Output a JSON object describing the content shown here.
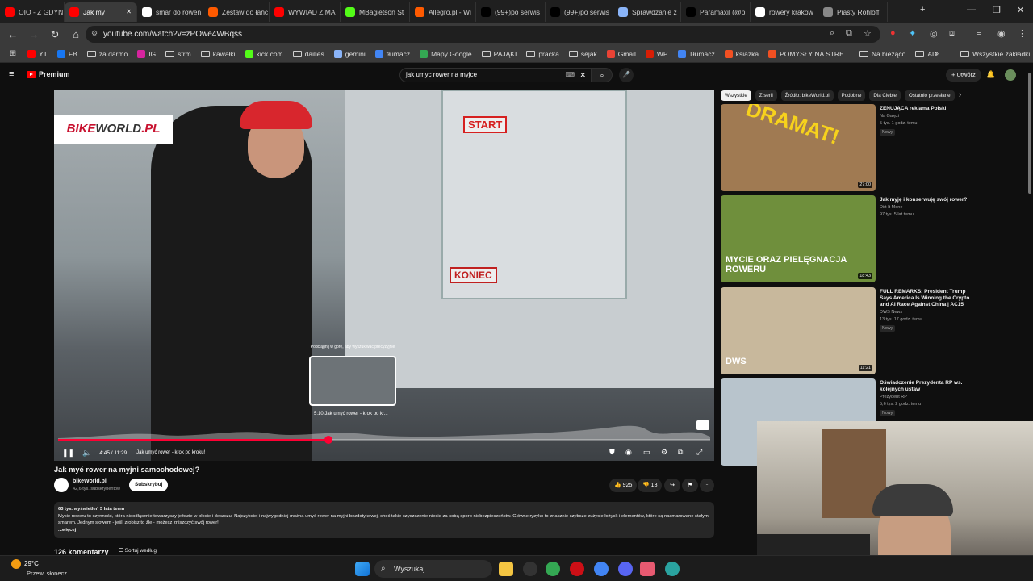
{
  "browser": {
    "tabs": [
      {
        "label": "OIO - Z GDYNI",
        "color": "#ff0000",
        "active": false
      },
      {
        "label": "Jak my",
        "color": "#ff0000",
        "active": true
      },
      {
        "label": "smar do rowen",
        "color": "#ffffff",
        "active": false
      },
      {
        "label": "Zestaw do łańc",
        "color": "#ff5a00",
        "active": false
      },
      {
        "label": "WYWIAD Z MA",
        "color": "#ff0000",
        "active": false
      },
      {
        "label": "MBagietson St",
        "color": "#53fc18",
        "active": false
      },
      {
        "label": "Allegro.pl - Wi",
        "color": "#ff5a00",
        "active": false
      },
      {
        "label": "(99+)po serwis",
        "color": "#000000",
        "active": false
      },
      {
        "label": "(99+)po serwis",
        "color": "#000000",
        "active": false
      },
      {
        "label": "Sprawdzanie z",
        "color": "#8ab4f8",
        "active": false
      },
      {
        "label": "Paramaxil (@p",
        "color": "#000000",
        "active": false
      },
      {
        "label": "rowery krakow",
        "color": "#ffffff",
        "active": false
      },
      {
        "label": "Piasty Rohloff",
        "color": "#888888",
        "active": false
      }
    ],
    "url": "youtube.com/watch?v=zPOwe4WBqss",
    "bookmarks": [
      {
        "label": "YT",
        "kind": "yt"
      },
      {
        "label": "FB",
        "kind": "fb"
      },
      {
        "label": "za darmo",
        "kind": "folder"
      },
      {
        "label": "IG",
        "kind": "ig"
      },
      {
        "label": "strm",
        "kind": "folder"
      },
      {
        "label": "kawałki",
        "kind": "folder"
      },
      {
        "label": "kick.com",
        "kind": "kick"
      },
      {
        "label": "dailies",
        "kind": "folder"
      },
      {
        "label": "gemini",
        "kind": "gemini"
      },
      {
        "label": "tłumacz",
        "kind": "gt"
      },
      {
        "label": "Mapy Google",
        "kind": "maps"
      },
      {
        "label": "PAJĄKI",
        "kind": "folder"
      },
      {
        "label": "pracka",
        "kind": "folder"
      },
      {
        "label": "sejak",
        "kind": "folder"
      },
      {
        "label": "Gmail",
        "kind": "gmail"
      },
      {
        "label": "WP",
        "kind": "wp"
      },
      {
        "label": "Tłumacz",
        "kind": "gt"
      },
      {
        "label": "ksiazka",
        "kind": "ms"
      },
      {
        "label": "POMYSŁY NA STRE...",
        "kind": "ms"
      },
      {
        "label": "Na bieżąco",
        "kind": "folder"
      },
      {
        "label": "AD",
        "kind": "folder"
      }
    ],
    "all_bookmarks": "Wszystkie zakładki"
  },
  "youtube": {
    "logo": "Premium",
    "search_query": "jak umyc rower na myjce",
    "create_label": "Utwórz",
    "player": {
      "brand_watermark": "BIKEWORLD.PL",
      "time": "4:45 / 11:29",
      "chapter": "Jak umyć rower - krok po kroku!",
      "played_fraction": 0.415,
      "preview_hint": "Podciągnij w górę, aby wyszukiwać precyzyjnie",
      "preview_time": "5:10  Jak umyć rower - krok po kr..."
    },
    "video_title": "Jak myć rower na myjni samochodowej?",
    "channel": {
      "name": "bikeWorld.pl",
      "subs": "42,6 tys. subskrybentów"
    },
    "subscribe_label": "Subskrybuj",
    "likes": "925",
    "dislikes": "18",
    "description": {
      "views": "63 tys. wyświetleń  3 lata temu",
      "text": "Mycie roweru to czynność, która nieodłącznie towarzyszy jeździe w błocie i deszczu. Najszybciej i najwygodniej można umyć rower na myjni bezdotykowej, choć takie czyszczenie niesie za sobą sporo niebezpieczeństw. Główne ryzyko to znacznie szybsze zużycie łożysk i elementów, które są nasmarowane stałym smarem. Jednym słowem - jeśli zrobisz to źle - możesz zniszczyć swój rower!",
      "more": "...więcej"
    },
    "comments_count": "126 komentarzy",
    "sort_label": "Sortuj według",
    "chips": [
      "Wszystkie",
      "Z serii",
      "Źródło: bikeWorld.pl",
      "Podobne",
      "Dla Ciebie",
      "Ostatnio przesłane"
    ],
    "recommendations": [
      {
        "title": "ZENUJĄCA reklama Polski",
        "channel": "Na Gałęzi",
        "meta": "5 tys.   1 godz. temu",
        "badge": "Nowy",
        "duration": "27:00",
        "thumb": "#a07a52",
        "overlay": "DRAMAT!"
      },
      {
        "title": "Jak myję i konserwuję swój rower?",
        "channel": "Dirt It Mone",
        "meta": "97 tys.   5 lat temu",
        "badge": "",
        "duration": "18:43",
        "thumb": "#6f8f3c",
        "overlay": "MYCIE ORAZ PIELĘGNACJA ROWERU"
      },
      {
        "title": "FULL REMARKS: President Trump Says America Is Winning the Crypto and AI Race Against China | AC15",
        "channel": "DWS News",
        "meta": "13 tys.   17 godz. temu",
        "badge": "Nowy",
        "duration": "11:21",
        "thumb": "#c8b89c",
        "overlay": "DWS"
      },
      {
        "title": "Oświadczenie Prezydenta RP ws. kolejnych ustaw",
        "channel": "Prezydent RP",
        "meta": "5,6 tys.   2 godz. temu",
        "badge": "Nowy",
        "duration": "",
        "thumb": "#b8c4cc",
        "overlay": ""
      }
    ]
  },
  "taskbar": {
    "temp": "29°C",
    "weather": "Przew. słonecz.",
    "search_placeholder": "Wyszukaj"
  }
}
